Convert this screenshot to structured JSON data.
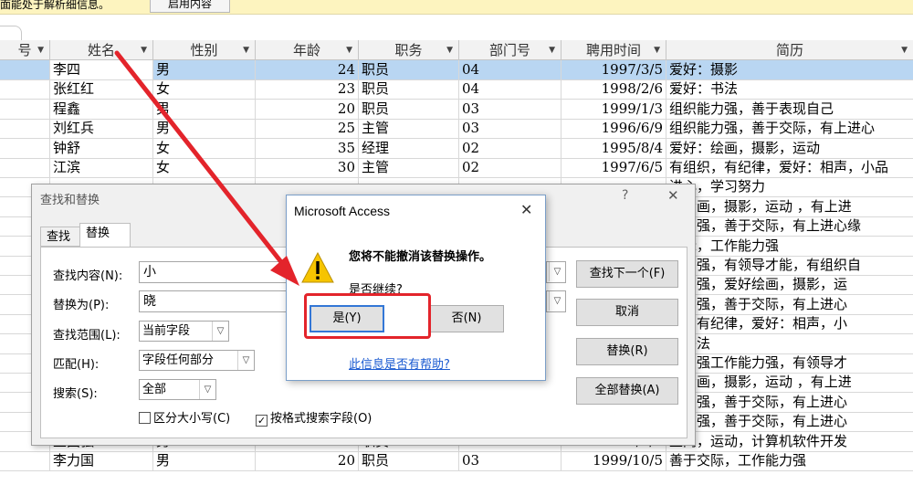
{
  "infobar": {
    "message": "面能处于解析细信息。",
    "button": "启用内容"
  },
  "table": {
    "columns": [
      "号",
      "姓名",
      "性别",
      "年龄",
      "职务",
      "部门号",
      "聘用时间",
      "简历"
    ],
    "rows": [
      [
        "",
        "李四",
        "男",
        "24",
        "职员",
        "04",
        "1997/3/5",
        "爱好：摄影"
      ],
      [
        "",
        "张红红",
        "女",
        "23",
        "职员",
        "04",
        "1998/2/6",
        "爱好：书法"
      ],
      [
        "",
        "程鑫",
        "男",
        "20",
        "职员",
        "03",
        "1999/1/3",
        "组织能力强，善于表现自己"
      ],
      [
        "",
        "刘红兵",
        "男",
        "25",
        "主管",
        "03",
        "1996/6/9",
        "组织能力强，善于交际，有上进心"
      ],
      [
        "",
        "钟舒",
        "女",
        "35",
        "经理",
        "02",
        "1995/8/4",
        "爱好：绘画，摄影，运动"
      ],
      [
        "",
        "江滨",
        "女",
        "30",
        "主管",
        "02",
        "1997/6/5",
        "有组织，有纪律，爱好：相声，小品"
      ],
      [
        "",
        "",
        "",
        "",
        "",
        "",
        "",
        "进心，学习努力"
      ],
      [
        "",
        "",
        "",
        "",
        "",
        "",
        "",
        "：绘画，摄影，运动 ，有上进"
      ],
      [
        "",
        "",
        "",
        "",
        "",
        "",
        "",
        "能力强，善于交际，有上进心缘"
      ],
      [
        "",
        "",
        "",
        "",
        "",
        "",
        "",
        "交际，工作能力强"
      ],
      [
        "",
        "",
        "",
        "",
        "",
        "",
        "",
        "能力强，有领导才能，有组织自"
      ],
      [
        "",
        "",
        "",
        "",
        "",
        "",
        "",
        "能力强，爱好绘画，摄影，运"
      ],
      [
        "",
        "",
        "",
        "",
        "",
        "",
        "",
        "能力强，善于交际，有上进心"
      ],
      [
        "",
        "",
        "",
        "",
        "",
        "",
        "",
        "织，有纪律，爱好：相声，小"
      ],
      [
        "",
        "",
        "",
        "",
        "",
        "",
        "",
        "：书法"
      ],
      [
        "",
        "",
        "",
        "",
        "",
        "",
        "",
        "能力强工作能力强，有领导才"
      ],
      [
        "",
        "",
        "",
        "",
        "",
        "",
        "",
        "：绘画，摄影，运动 ，有上进"
      ],
      [
        "",
        "",
        "",
        "",
        "",
        "",
        "",
        "能力强，善于交际，有上进心"
      ],
      [
        "",
        "",
        "",
        "",
        "",
        "",
        "",
        "能力强，善于交际，有上进心"
      ],
      [
        "",
        "王国强",
        "男",
        "18",
        "职员",
        "02",
        "2001/9/8",
        "上网，运动，计算机软件开发"
      ],
      [
        "",
        "李力国",
        "男",
        "20",
        "职员",
        "03",
        "1999/10/5",
        "善于交际，工作能力强"
      ]
    ]
  },
  "find_dialog": {
    "title": "查找和替换",
    "help": "?",
    "close": "✕",
    "tab_find": "查找",
    "tab_replace": "替换",
    "find_label": "查找内容(N):",
    "find_value": "小",
    "replace_label": "替换为(P):",
    "replace_value": "晓",
    "scope_label": "查找范围(L):",
    "scope_value": "当前字段",
    "match_label": "匹配(H):",
    "match_value": "字段任何部分",
    "search_label": "搜索(S):",
    "search_value": "全部",
    "match_case": "区分大小写(C)",
    "search_formatted": "按格式搜索字段(O)",
    "btn_find_next": "查找下一个(F)",
    "btn_cancel": "取消",
    "btn_replace": "替换(R)",
    "btn_replace_all": "全部替换(A)"
  },
  "msgbox": {
    "title": "Microsoft Access",
    "close": "✕",
    "line1": "您将不能撤消该替换操作。",
    "line2": "是否继续?",
    "yes": "是(Y)",
    "no": "否(N)",
    "help_link": "此信息是否有帮助?"
  },
  "colors": {
    "annotation": "#e3242b",
    "selected_row": "#b9d6f2",
    "link": "#1b5bd1"
  }
}
